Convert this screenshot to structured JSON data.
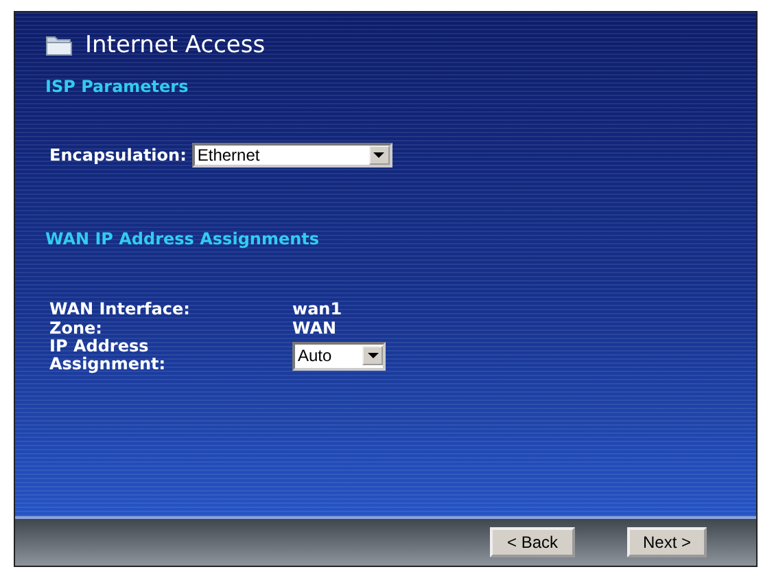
{
  "title": "Internet Access",
  "isp_parameters": {
    "heading": "ISP Parameters",
    "encapsulation": {
      "label": "Encapsulation:",
      "value": "Ethernet"
    }
  },
  "wan_ip_address_assignments": {
    "heading": "WAN IP Address Assignments",
    "rows": [
      {
        "kind": "text",
        "label": "WAN Interface:",
        "value": "wan1"
      },
      {
        "kind": "text",
        "label": "Zone:",
        "value": "WAN"
      },
      {
        "kind": "select",
        "label": "IP Address Assignment:",
        "value": "Auto"
      }
    ]
  },
  "buttons": [
    "< Back",
    "Next >"
  ]
}
